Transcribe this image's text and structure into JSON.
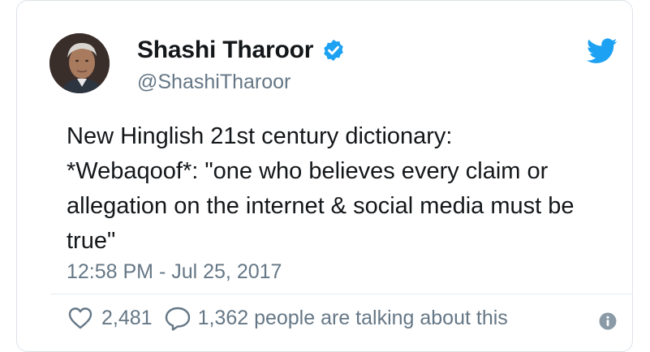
{
  "author": {
    "name": "Shashi Tharoor",
    "handle": "@ShashiTharoor",
    "verified": true
  },
  "icons": {
    "verified": "verified-badge-icon",
    "brand": "twitter-bird-icon",
    "like": "heart-icon",
    "reply": "speech-bubble-icon",
    "info": "info-icon"
  },
  "colors": {
    "brand_blue": "#1da1f2",
    "text": "#14171a",
    "secondary": "#657786"
  },
  "tweet": {
    "lines": [
      "New Hinglish 21st century dictionary:",
      "*Webaqoof*: \"one who believes every claim or",
      "allegation on the internet & social media must be",
      "true\""
    ],
    "timestamp": "12:58 PM - Jul 25, 2017"
  },
  "actions": {
    "like_count": "2,481",
    "talking_text": "1,362 people are talking about this"
  }
}
